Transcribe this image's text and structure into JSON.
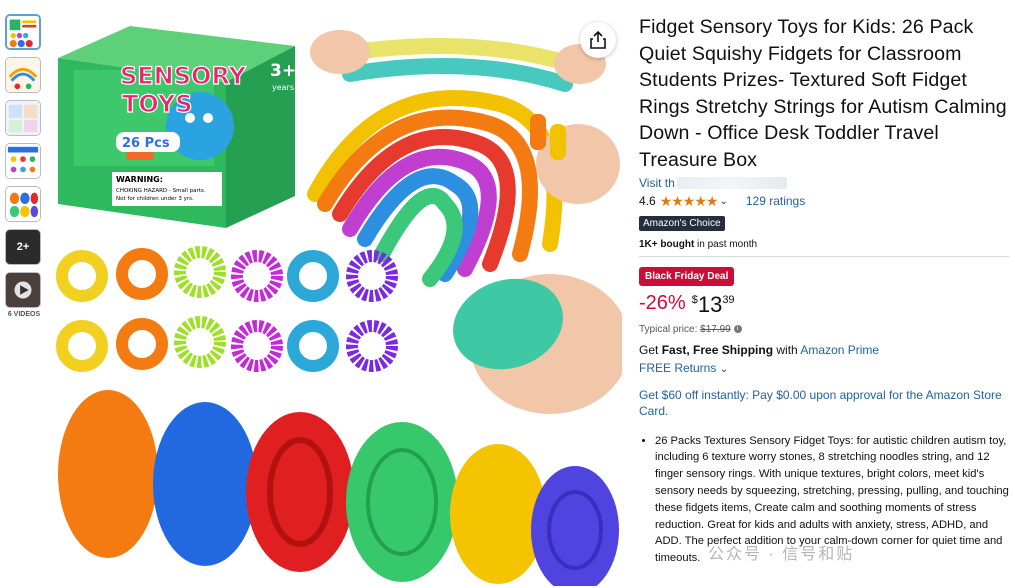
{
  "gallery": {
    "more_count": "2+",
    "videos_label": "6 VIDEOS"
  },
  "main_image": {
    "box_brand_title_line1": "SENSORY",
    "box_brand_title_line2": "TOYS",
    "box_age": "3+",
    "box_age_unit": "years",
    "box_count": "26 Pcs",
    "box_warning_title": "WARNING:",
    "box_warning_text": "CHOKING HAZARD - Small parts.",
    "box_warning_sub": "Not for children under 3 yrs."
  },
  "product": {
    "title": "Fidget Sensory Toys for Kids: 26 Pack Quiet Squishy Fidgets for Classroom Students Prizes- Textured Soft Fidget Rings Stretchy Strings for Autism Calming Down - Office Desk Toddler Travel Treasure Box",
    "visit_store": "Visit th",
    "rating": "4.6",
    "ratings_count": "129 ratings",
    "badge": "Amazon's Choice",
    "bought_bold": "1K+ bought",
    "bought_rest": " in past month"
  },
  "pricing": {
    "deal_badge": "Black Friday Deal",
    "discount": "-26%",
    "currency": "$",
    "whole": "13",
    "fraction": "39",
    "typical_label": "Typical price: ",
    "typical_price": "$17.99"
  },
  "shipping": {
    "prefix": "Get ",
    "bold": "Fast, Free Shipping",
    "middle": " with ",
    "link": "Amazon Prime",
    "returns": "FREE Returns"
  },
  "promo": "Get $60 off instantly: Pay $0.00 upon approval for the Amazon Store Card.",
  "bullets": [
    "26 Packs Textures Sensory Fidget Toys: for autistic children autism toy, including 6 texture worry stones, 8 stretching noodles string, and 12 finger sensory rings. With unique textures, bright colors, meet kid's sensory needs by squeezing, stretching, pressing, pulling, and touching these fidgets items, Create calm and soothing moments of stress reduction. Great for kids and adults with anxiety, stress, ADHD, and ADD. The perfect addition to your calm-down corner for quiet time and timeouts."
  ],
  "watermark": "公众号 · 信号和贴",
  "colors": {
    "link": "#2162a1",
    "deal": "#cc0c39",
    "star": "#e47911",
    "badge": "#232f3e"
  }
}
